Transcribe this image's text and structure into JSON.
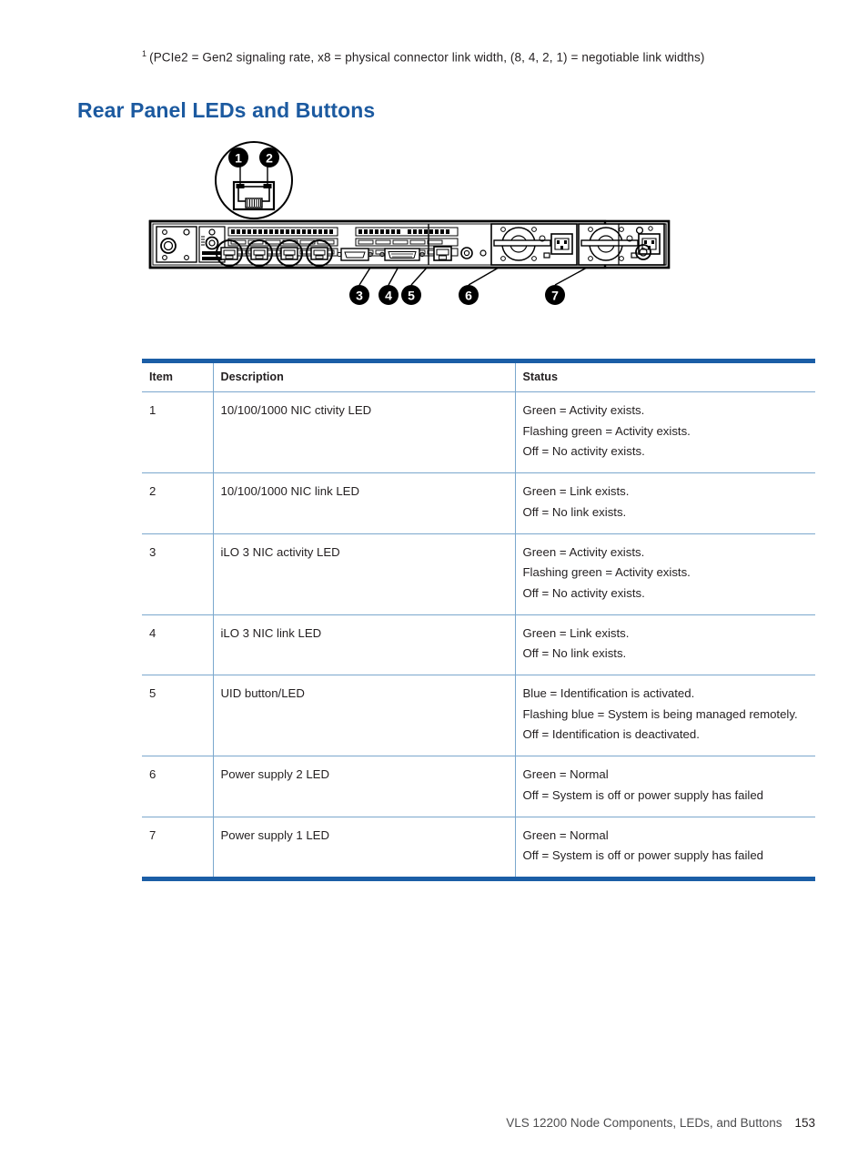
{
  "footnote": {
    "marker": "1",
    "text": "(PCIe2 = Gen2 signaling rate, x8 = physical connector link width, (8, 4, 2, 1) = negotiable link widths)"
  },
  "heading": "Rear Panel LEDs and Buttons",
  "figure": {
    "name": "rear-panel-diagram",
    "detail_callouts": [
      "1",
      "2"
    ],
    "panel_callouts": [
      "3",
      "4",
      "5",
      "6",
      "7"
    ],
    "colors": {
      "badge_fill": "#000000",
      "badge_text": "#ffffff",
      "outline": "#000000"
    }
  },
  "table": {
    "columns": [
      "Item",
      "Description",
      "Status"
    ],
    "rows": [
      {
        "item": "1",
        "description": "10/100/1000 NIC ctivity LED",
        "status": [
          "Green = Activity exists.",
          "Flashing green = Activity exists.",
          "Off = No activity exists."
        ]
      },
      {
        "item": "2",
        "description": "10/100/1000 NIC link LED",
        "status": [
          "Green = Link exists.",
          "Off = No link exists."
        ]
      },
      {
        "item": "3",
        "description": "iLO 3 NIC activity LED",
        "status": [
          "Green = Activity exists.",
          "Flashing green = Activity exists.",
          "Off = No activity exists."
        ]
      },
      {
        "item": "4",
        "description": "iLO 3 NIC link LED",
        "status": [
          "Green = Link exists.",
          "Off = No link exists."
        ]
      },
      {
        "item": "5",
        "description": "UID button/LED",
        "status": [
          "Blue = Identification is activated.",
          "Flashing blue = System is being managed remotely.",
          "Off = Identification is deactivated."
        ]
      },
      {
        "item": "6",
        "description": "Power supply 2 LED",
        "status": [
          "Green = Normal",
          "Off = System is off or power supply has failed"
        ]
      },
      {
        "item": "7",
        "description": "Power supply 1 LED",
        "status": [
          "Green = Normal",
          "Off = System is off or power supply has failed"
        ]
      }
    ],
    "colors": {
      "rule_heavy": "#1b5ea6",
      "rule_light": "#7ba7cd"
    }
  },
  "footer": {
    "title": "VLS 12200 Node Components, LEDs, and Buttons",
    "page_number": "153"
  }
}
